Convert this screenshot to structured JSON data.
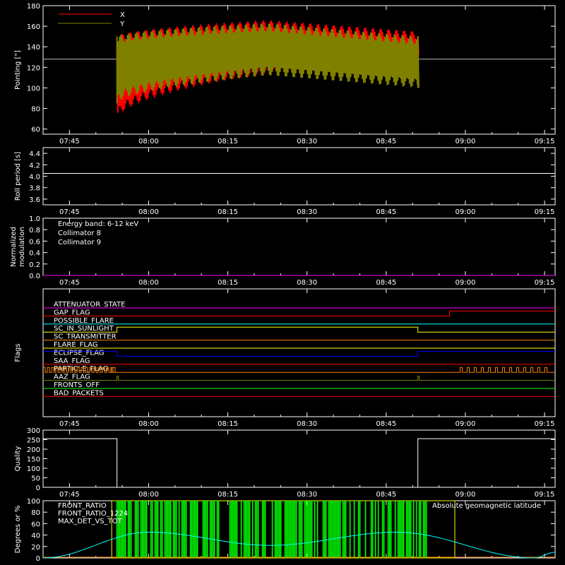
{
  "time_ticks": [
    "07:45",
    "08:00",
    "08:15",
    "08:30",
    "08:45",
    "09:00",
    "09:15"
  ],
  "chart_data": [
    {
      "id": "pointing",
      "type": "line",
      "ylabel": "Pointing [\"]",
      "ylim": [
        55,
        180
      ],
      "yticks": [
        60,
        80,
        100,
        120,
        140,
        160,
        180
      ],
      "baseline": 128,
      "legend": [
        "X",
        "Y"
      ],
      "colors": {
        "X": "#ff0000",
        "Y": "#808000"
      },
      "data_start": "07:54",
      "data_end": "08:51",
      "x_series": {
        "name": "X",
        "envelope_start": [
          70,
          150
        ],
        "envelope_mid": [
          115,
          166
        ],
        "envelope_end": [
          127,
          155
        ]
      },
      "y_series": {
        "name": "Y",
        "envelope_start": [
          85,
          150
        ],
        "envelope_mid": [
          112,
          163
        ],
        "envelope_end": [
          100,
          150
        ]
      }
    },
    {
      "id": "roll",
      "type": "line",
      "ylabel": "Roll period [s]",
      "ylim": [
        3.5,
        4.5
      ],
      "yticks": [
        3.6,
        3.8,
        4.0,
        4.2,
        4.4
      ],
      "value": 4.05
    },
    {
      "id": "modulation",
      "type": "line",
      "ylabel_line1": "Normalized",
      "ylabel_line2": "modulation",
      "ylim": [
        0,
        1
      ],
      "yticks": [
        0.0,
        0.2,
        0.4,
        0.6,
        0.8,
        1.0
      ],
      "legend": [
        {
          "name": "Energy band: 6-12 keV",
          "color": "#ffffff"
        },
        {
          "name": "Collimator 8",
          "color": "#00ffff"
        },
        {
          "name": "Collimator 9",
          "color": "#ff00ff"
        }
      ],
      "value": 0.0
    },
    {
      "id": "flags",
      "type": "line",
      "ylabel": "Flags",
      "flags": [
        {
          "name": "ATTENUATOR_STATE",
          "color": "#ff00ff"
        },
        {
          "name": "GAP_FLAG",
          "color": "#ff0000"
        },
        {
          "name": "POSSIBLE_FLARE",
          "color": "#00ffff"
        },
        {
          "name": "SC_IN_SUNLIGHT",
          "color": "#ffff00"
        },
        {
          "name": "SC_TRANSMITTER",
          "color": "#ff8000"
        },
        {
          "name": "FLARE_FLAG",
          "color": "#ffff00"
        },
        {
          "name": "ECLIPSE_FLAG",
          "color": "#0000ff"
        },
        {
          "name": "SAA_FLAG",
          "color": "#ff0000"
        },
        {
          "name": "PARTICLE_FLAG",
          "color": "#ff8000"
        },
        {
          "name": "AAZ_FLAG",
          "color": "#808000"
        },
        {
          "name": "FRONTS_OFF",
          "color": "#00ff00"
        },
        {
          "name": "BAD_PACKETS",
          "color": "#ff0000"
        }
      ]
    },
    {
      "id": "quality",
      "type": "line",
      "ylabel": "Quality",
      "ylim": [
        0,
        300
      ],
      "yticks": [
        0,
        50,
        100,
        150,
        200,
        250,
        300
      ],
      "segments": [
        {
          "start": "07:40",
          "end": "07:54",
          "value": 255
        },
        {
          "start": "07:54",
          "end": "08:51",
          "value": 0
        },
        {
          "start": "08:51",
          "end": "09:17",
          "value": 255
        }
      ]
    },
    {
      "id": "ratios",
      "type": "line",
      "ylabel": "Degrees or %",
      "ylim": [
        0,
        100
      ],
      "yticks": [
        0,
        20,
        40,
        60,
        80,
        100
      ],
      "legend": [
        {
          "name": "FRONT_RATIO",
          "color": "#ffff00"
        },
        {
          "name": "FRONT_RATIO_1224",
          "color": "#00ff00"
        },
        {
          "name": "MAX_DET_VS_TOT",
          "color": "#ff8000"
        }
      ],
      "right_label": "Absolute geomagnetic latitude",
      "right_label_color": "#00ffff",
      "latitude_peaks": [
        {
          "time": "08:00",
          "value": 45
        },
        {
          "time": "08:47",
          "value": 45
        }
      ],
      "latitude_minima": [
        {
          "time": "07:40",
          "value": 0
        },
        {
          "time": "08:23",
          "value": 22
        },
        {
          "time": "09:13",
          "value": 0
        }
      ]
    }
  ]
}
